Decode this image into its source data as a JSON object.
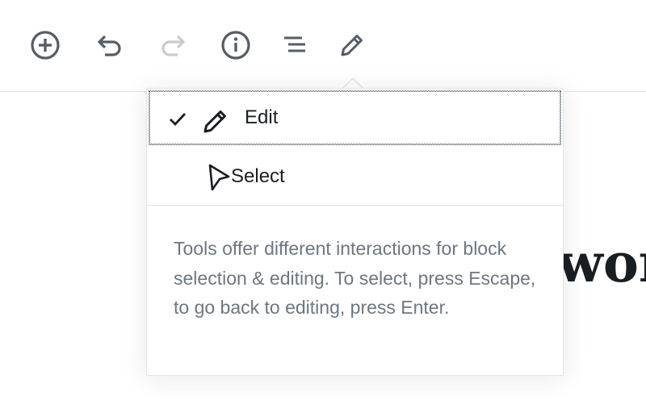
{
  "toolbar": {
    "buttons": [
      {
        "name": "add-block",
        "icon": "plus-circle-icon",
        "color": "#555d66"
      },
      {
        "name": "undo",
        "icon": "undo-icon",
        "color": "#555d66"
      },
      {
        "name": "redo",
        "icon": "redo-icon",
        "color": "#c8ccd0",
        "disabled": true
      },
      {
        "name": "info",
        "icon": "info-icon",
        "color": "#555d66"
      },
      {
        "name": "outline",
        "icon": "list-view-icon",
        "color": "#555d66"
      },
      {
        "name": "tools",
        "icon": "pencil-icon",
        "color": "#555d66"
      }
    ]
  },
  "canvas": {
    "heading_fragment": "wor"
  },
  "tools_menu": {
    "items": [
      {
        "label": "Edit",
        "icon": "pencil-icon",
        "checked": true,
        "focused": true
      },
      {
        "label": "Select",
        "icon": "pointer-icon",
        "checked": false,
        "focused": false
      }
    ],
    "help_text": "Tools offer different interactions for block selection & editing. To select, press Escape, to go back to editing, press Enter."
  },
  "colors": {
    "text": "#191e23",
    "muted_text": "#6c7781",
    "icon": "#555d66",
    "disabled_icon": "#c8ccd0",
    "border": "#e2e4e7"
  }
}
